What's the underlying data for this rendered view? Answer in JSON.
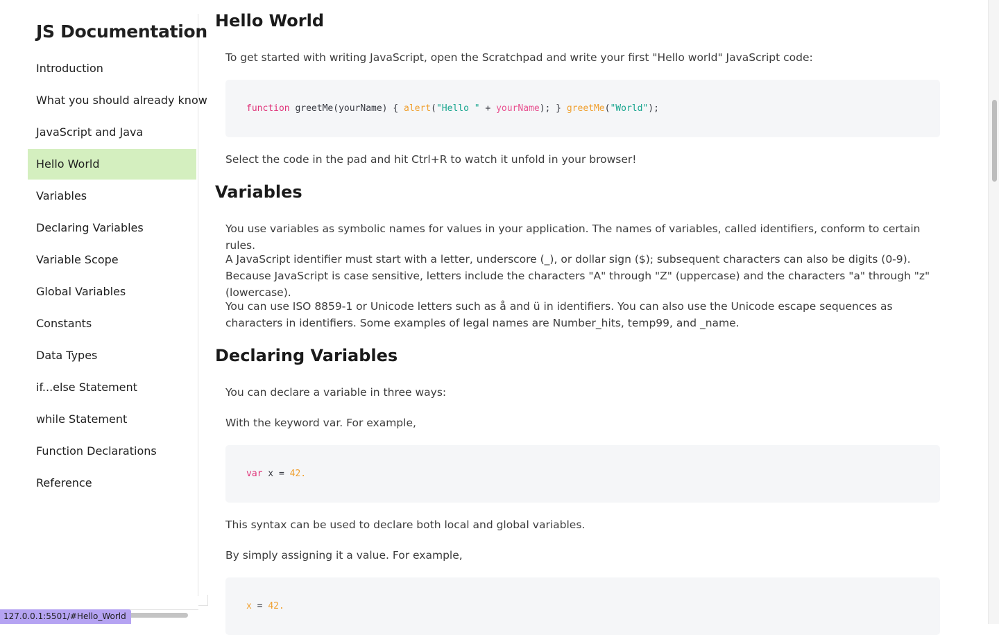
{
  "nav": {
    "title": "JS Documentation",
    "items": [
      {
        "label": "Introduction"
      },
      {
        "label": "What you should already know"
      },
      {
        "label": "JavaScript and Java"
      },
      {
        "label": "Hello World",
        "active": true
      },
      {
        "label": "Variables"
      },
      {
        "label": "Declaring Variables"
      },
      {
        "label": "Variable Scope"
      },
      {
        "label": "Global Variables"
      },
      {
        "label": "Constants"
      },
      {
        "label": "Data Types"
      },
      {
        "label": "if...else Statement"
      },
      {
        "label": "while Statement"
      },
      {
        "label": "Function Declarations"
      },
      {
        "label": "Reference"
      }
    ]
  },
  "status_url": "127.0.0.1:5501/#Hello_World",
  "sections": {
    "hello": {
      "title": "Hello World",
      "intro": "To get started with writing JavaScript, open the Scratchpad and write your first \"Hello world\" JavaScript code:",
      "code": {
        "kw_function": "function",
        "name_decl": " greetMe(yourName) { ",
        "alert": "alert",
        "paren1": "(",
        "str_hello": "\"Hello \"",
        "plus": " + ",
        "your_name": "yourName",
        "close1": "); } ",
        "greet_call": "greetMe",
        "paren2": "(",
        "str_world": "\"World\"",
        "close2": ");"
      },
      "after": "Select the code in the pad and hit Ctrl+R to watch it unfold in your browser!"
    },
    "variables": {
      "title": "Variables",
      "p1": "You use variables as symbolic names for values in your application. The names of variables, called identifiers, conform to certain rules.",
      "p2": "A JavaScript identifier must start with a letter, underscore (_), or dollar sign ($); subsequent characters can also be digits (0-9). Because JavaScript is case sensitive, letters include the characters \"A\" through \"Z\" (uppercase) and the characters \"a\" through \"z\" (lowercase).",
      "p3": "You can use ISO 8859-1 or Unicode letters such as å and ü in identifiers. You can also use the Unicode escape sequences as characters in identifiers. Some examples of legal names are Number_hits, temp99, and _name."
    },
    "declaring": {
      "title": "Declaring Variables",
      "p1": "You can declare a variable in three ways:",
      "p2": "With the keyword var. For example,",
      "code1": {
        "kw": "var",
        "rest": " x = ",
        "num": "42."
      },
      "p3": "This syntax can be used to declare both local and global variables.",
      "p4": "By simply assigning it a value. For example,",
      "code2": {
        "var": "x",
        "rest": " = ",
        "num": "42."
      }
    }
  }
}
